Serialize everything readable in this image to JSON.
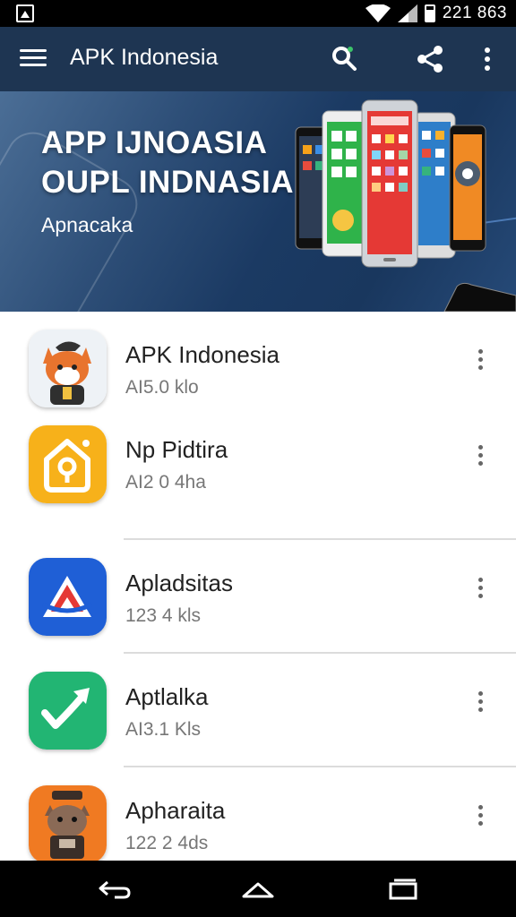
{
  "status_bar": {
    "time": "221 863"
  },
  "app_bar": {
    "title": "APK Indonesia"
  },
  "banner": {
    "headline_line1": "APP IJNOASIA",
    "headline_line2": "OUPL INDNASIA",
    "subtitle": "Apnacaka"
  },
  "apps": [
    {
      "name": "APK Indonesia",
      "meta": "AI5.0 klo",
      "icon": "cat-icon"
    },
    {
      "name": "Np Pidtira",
      "meta": "AI2 0 4ha",
      "icon": "home-icon"
    },
    {
      "name": "Apladsitas",
      "meta": "123 4 kls",
      "icon": "triangle-logo-icon"
    },
    {
      "name": "Aptlalka",
      "meta": "AI3.1 Kls",
      "icon": "arrow-icon"
    },
    {
      "name": "Apharaita",
      "meta": "122 2 4ds",
      "icon": "robot-cat-icon"
    }
  ],
  "colors": {
    "app_bar": "#1e3552",
    "banner": "#1b3a63",
    "navbar": "#000000"
  }
}
